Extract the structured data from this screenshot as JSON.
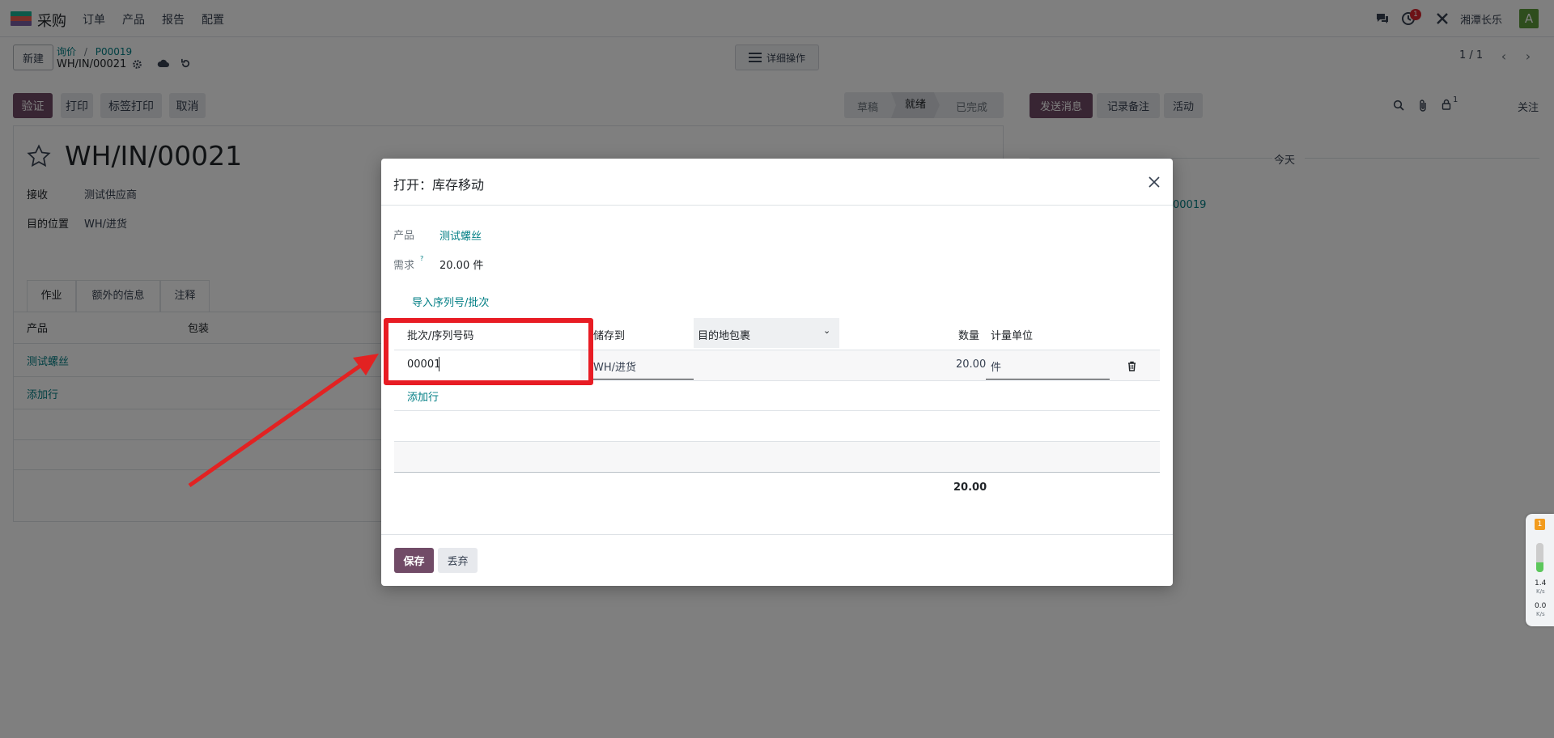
{
  "topbar": {
    "app_name": "采购",
    "menus": [
      "订单",
      "产品",
      "报告",
      "配置"
    ],
    "activity_badge": "1",
    "company": "湘潭长乐",
    "avatar_letter": "A"
  },
  "control": {
    "new_label": "新建",
    "breadcrumb_parent": "询价",
    "breadcrumb_sep": "/",
    "breadcrumb_current": "P00019",
    "record_name": "WH/IN/00021",
    "detail_ops_label": "详细操作",
    "pager": "1 / 1"
  },
  "actions": {
    "validate": "验证",
    "print": "打印",
    "label_print": "标签打印",
    "cancel": "取消"
  },
  "status": {
    "steps": [
      "草稿",
      "就绪",
      "已完成"
    ],
    "active_index": 1
  },
  "chatter": {
    "send_message": "发送消息",
    "log_note": "记录备注",
    "activity": "活动",
    "attachment_count": "1",
    "follow": "关注",
    "today": "今天",
    "link_fragment": "00019"
  },
  "form": {
    "title": "WH/IN/00021",
    "receive_label": "接收",
    "receive_value": "测试供应商",
    "dest_label": "目的位置",
    "dest_value": "WH/进货",
    "tabs": [
      "作业",
      "额外的信息",
      "注释"
    ],
    "col_product": "产品",
    "col_packaging": "包装",
    "row_product": "测试螺丝",
    "add_line": "添加行"
  },
  "dialog": {
    "title": "打开：库存移动",
    "product_label": "产品",
    "product_value": "测试螺丝",
    "demand_label": "需求",
    "demand_tip": "?",
    "demand_value": "20.00 件",
    "import_link": "导入序列号/批次",
    "columns": {
      "lot": "批次/序列号码",
      "store_to": "储存到",
      "dest_package": "目的地包裹",
      "qty": "数量",
      "uom": "计量单位"
    },
    "row": {
      "lot": "00001",
      "store_to": "WH/进货",
      "qty": "20.00",
      "uom": "件"
    },
    "add_line": "添加行",
    "total": "20.00",
    "save": "保存",
    "discard": "丢弃"
  },
  "net_widget": {
    "badge": "1",
    "up": "1.4",
    "down": "0.0",
    "unit": "K/s"
  },
  "colors": {
    "primary": "#714b67",
    "link": "#017e84",
    "highlight": "#e81c24",
    "arrow": "#e22222"
  }
}
